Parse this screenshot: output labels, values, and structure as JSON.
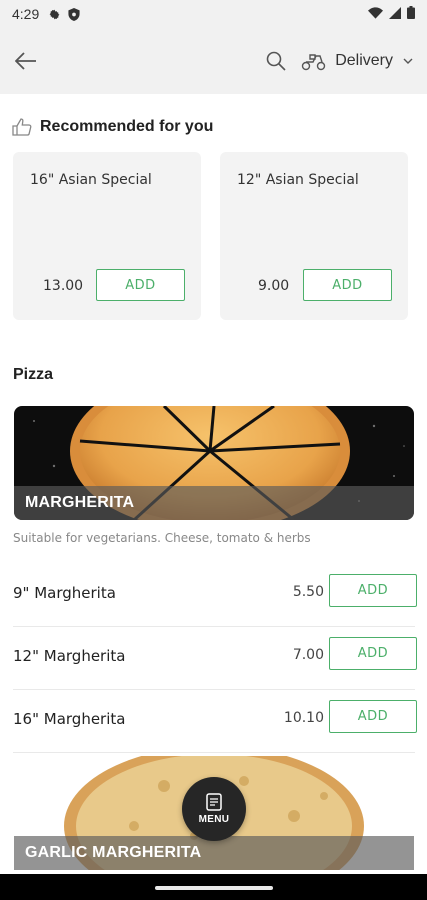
{
  "status_bar": {
    "time": "4:29"
  },
  "header": {
    "delivery_label": "Delivery"
  },
  "recommended": {
    "title": "Recommended for you",
    "items": [
      {
        "name": "16\" Asian Special",
        "price": "13.00",
        "add_label": "ADD"
      },
      {
        "name": "12\" Asian Special",
        "price": "9.00",
        "add_label": "ADD"
      }
    ]
  },
  "section": {
    "title": "Pizza",
    "banner_title": "MARGHERITA",
    "description": "Suitable for vegetarians. Cheese, tomato & herbs",
    "items": [
      {
        "name": "9\" Margherita",
        "price": "5.50",
        "add_label": "ADD"
      },
      {
        "name": "12\" Margherita",
        "price": "7.00",
        "add_label": "ADD"
      },
      {
        "name": "16\" Margherita",
        "price": "10.10",
        "add_label": "ADD"
      }
    ],
    "next_banner_title": "GARLIC MARGHERITA"
  },
  "fab": {
    "label": "MENU"
  },
  "colors": {
    "accent": "#4caf6a",
    "header_bg": "#f1f1f1",
    "fab_bg": "#262626"
  }
}
